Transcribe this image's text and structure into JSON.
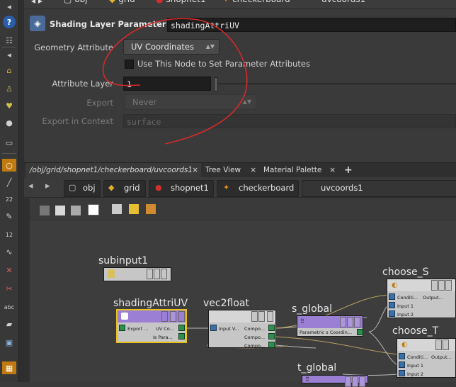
{
  "breadcrumb": {
    "items": [
      {
        "label": "obj",
        "icon": "obj-network-icon"
      },
      {
        "label": "grid",
        "icon": "grid-geo-icon"
      },
      {
        "label": "shopnet1",
        "icon": "shop-network-icon"
      },
      {
        "label": "checkerboard",
        "icon": "checkerboard-icon"
      },
      {
        "label": "uvcoords1",
        "icon": ""
      }
    ]
  },
  "params": {
    "node_type": "Shading Layer Parameter",
    "node_name": "shadingAttriUV",
    "geometry_attribute": {
      "label": "Geometry Attribute",
      "value": "UV Coordinates"
    },
    "use_node": {
      "label": "Use This Node to Set Parameter Attributes",
      "checked": false
    },
    "attribute_layer": {
      "label": "Attribute Layer",
      "value": "1"
    },
    "export": {
      "label": "Export",
      "value": "Never"
    },
    "export_context": {
      "label": "Export in Context",
      "value": "surface"
    }
  },
  "tabs": [
    {
      "label": "/obj/grid/shopnet1/checkerboard/uvcoords1",
      "active": true,
      "close": "×"
    },
    {
      "label": "Tree View",
      "active": false,
      "close": "×"
    },
    {
      "label": "Material Palette",
      "active": false,
      "close": "×"
    },
    {
      "label": "+",
      "active": false,
      "close": ""
    }
  ],
  "network": {
    "nodes": [
      {
        "name": "subinput1"
      },
      {
        "name": "shadingAttriUV",
        "ports_in": [
          "Export ..."
        ],
        "ports_out": [
          "UV Co...",
          "Is Para..."
        ]
      },
      {
        "name": "vec2float",
        "ports_in": [
          "Input V..."
        ],
        "ports_out": [
          "Compo...",
          "Compo...",
          "Compo..."
        ]
      },
      {
        "name": "s_global",
        "ports_out": [
          "Parametric s Coordin..."
        ]
      },
      {
        "name": "choose_S",
        "ports_in": [
          "Conditi...",
          "Input 1",
          "Input 2"
        ],
        "ports_out": [
          "Output..."
        ]
      },
      {
        "name": "choose_T",
        "ports_in": [
          "Conditi...",
          "Input 1",
          "Input 2"
        ],
        "ports_out": [
          "Output..."
        ]
      },
      {
        "name": "t_global"
      }
    ]
  },
  "colors": {
    "annotation": "#d42a2a",
    "selected_node": "#e8c020",
    "vop_purple": "#9b7fd4",
    "port_green": "#2d8f4e"
  }
}
